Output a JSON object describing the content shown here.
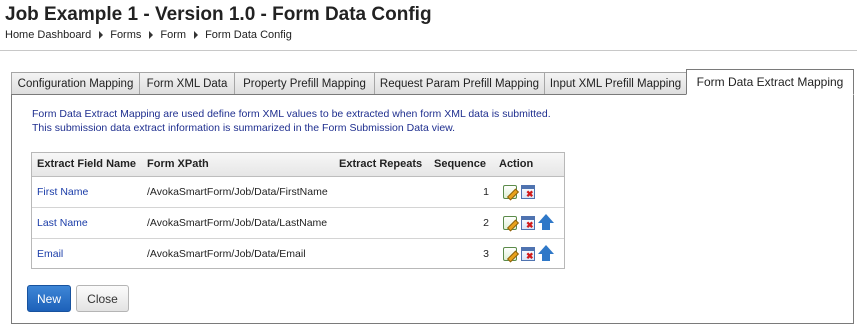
{
  "page": {
    "title": "Job Example 1 - Version 1.0 - Form Data Config"
  },
  "breadcrumb": [
    {
      "label": "Home Dashboard"
    },
    {
      "label": "Forms"
    },
    {
      "label": "Form"
    },
    {
      "label": "Form Data Config"
    }
  ],
  "tabs": [
    {
      "label": "Configuration Mapping",
      "active": false
    },
    {
      "label": "Form XML Data",
      "active": false
    },
    {
      "label": "Property Prefill Mapping",
      "active": false
    },
    {
      "label": "Request Param Prefill Mapping",
      "active": false
    },
    {
      "label": "Input XML Prefill Mapping",
      "active": false
    },
    {
      "label": "Form Data Extract Mapping",
      "active": true
    }
  ],
  "description": {
    "line1": "Form Data Extract Mapping are used define form XML values to be extracted when form XML data is submitted.",
    "line2": "This submission data extract information is summarized in the Form Submission Data view."
  },
  "table": {
    "headers": {
      "extract_field_name": "Extract Field Name",
      "form_xpath": "Form XPath",
      "extract_repeats": "Extract Repeats",
      "sequence": "Sequence",
      "action": "Action"
    },
    "rows": [
      {
        "name": "First Name",
        "xpath": "/AvokaSmartForm/Job/Data/FirstName",
        "repeats": "",
        "sequence": "1",
        "actions": [
          "edit-icon",
          "delete-icon"
        ]
      },
      {
        "name": "Last Name",
        "xpath": "/AvokaSmartForm/Job/Data/LastName",
        "repeats": "",
        "sequence": "2",
        "actions": [
          "edit-icon",
          "delete-icon",
          "move-up-icon"
        ]
      },
      {
        "name": "Email",
        "xpath": "/AvokaSmartForm/Job/Data/Email",
        "repeats": "",
        "sequence": "3",
        "actions": [
          "edit-icon",
          "delete-icon",
          "move-up-icon"
        ]
      }
    ]
  },
  "buttons": {
    "new_label": "New",
    "close_label": "Close"
  },
  "colors": {
    "primary_button": "#1d61b9",
    "link": "#1a3ca8",
    "description_text": "#1f2f8f"
  }
}
